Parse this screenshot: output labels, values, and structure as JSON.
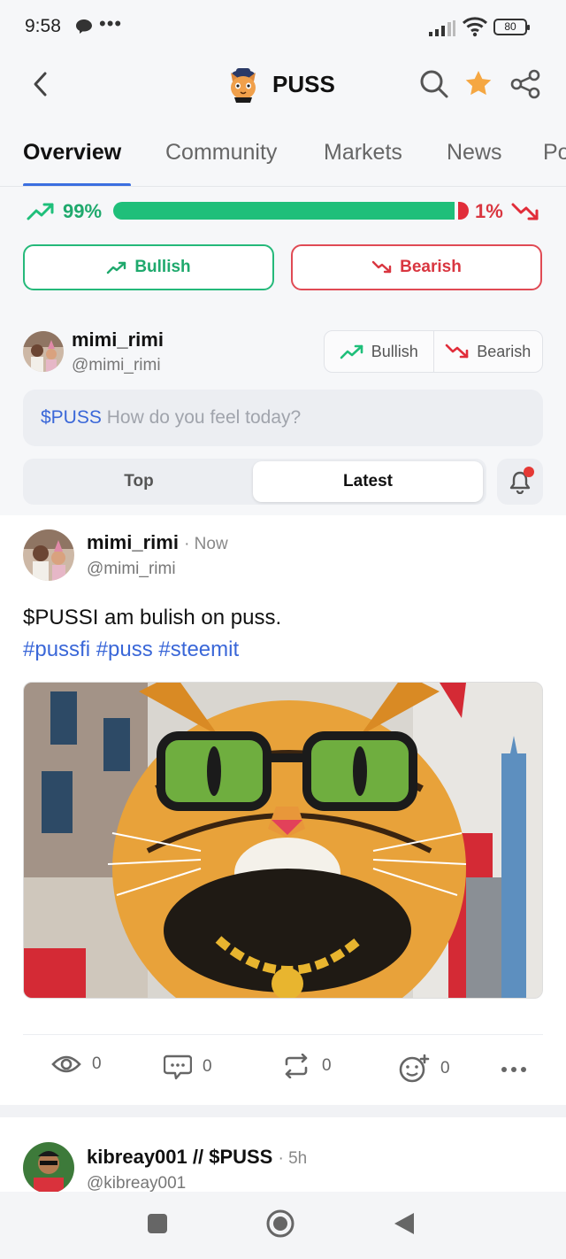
{
  "status_bar": {
    "time": "9:58",
    "extra": "•••",
    "battery": "80"
  },
  "header": {
    "title": "PUSS",
    "star_color": "#f5a742"
  },
  "tabs": [
    {
      "label": "Overview",
      "active": true
    },
    {
      "label": "Community",
      "active": false
    },
    {
      "label": "Markets",
      "active": false
    },
    {
      "label": "News",
      "active": false
    },
    {
      "label": "Po",
      "active": false
    }
  ],
  "sentiment": {
    "bullish_pct": "99%",
    "bearish_pct": "1%",
    "bullish_fraction": 0.99,
    "bull_color": "#1fbf7a",
    "bear_color": "#e12d3a",
    "bullish_label": "Bullish",
    "bearish_label": "Bearish"
  },
  "composer": {
    "user_name": "mimi_rimi",
    "user_handle": "@mimi_rimi",
    "toggle_bullish": "Bullish",
    "toggle_bearish": "Bearish",
    "ticker": "$PUSS",
    "placeholder": "How do you feel today?"
  },
  "feed_filter": {
    "top_label": "Top",
    "latest_label": "Latest",
    "selected": "Latest"
  },
  "posts": [
    {
      "user_name": "mimi_rimi",
      "time": "· Now",
      "handle": "@mimi_rimi",
      "text": "$PUSSI am bulish on puss.",
      "tags": "#pussfi #puss #steemit",
      "views": "0",
      "comments": "0",
      "reposts": "0",
      "reactions": "0"
    },
    {
      "user_name": "kibreay001 // $PUSS",
      "time": "· 5h",
      "handle": "@kibreay001"
    }
  ]
}
